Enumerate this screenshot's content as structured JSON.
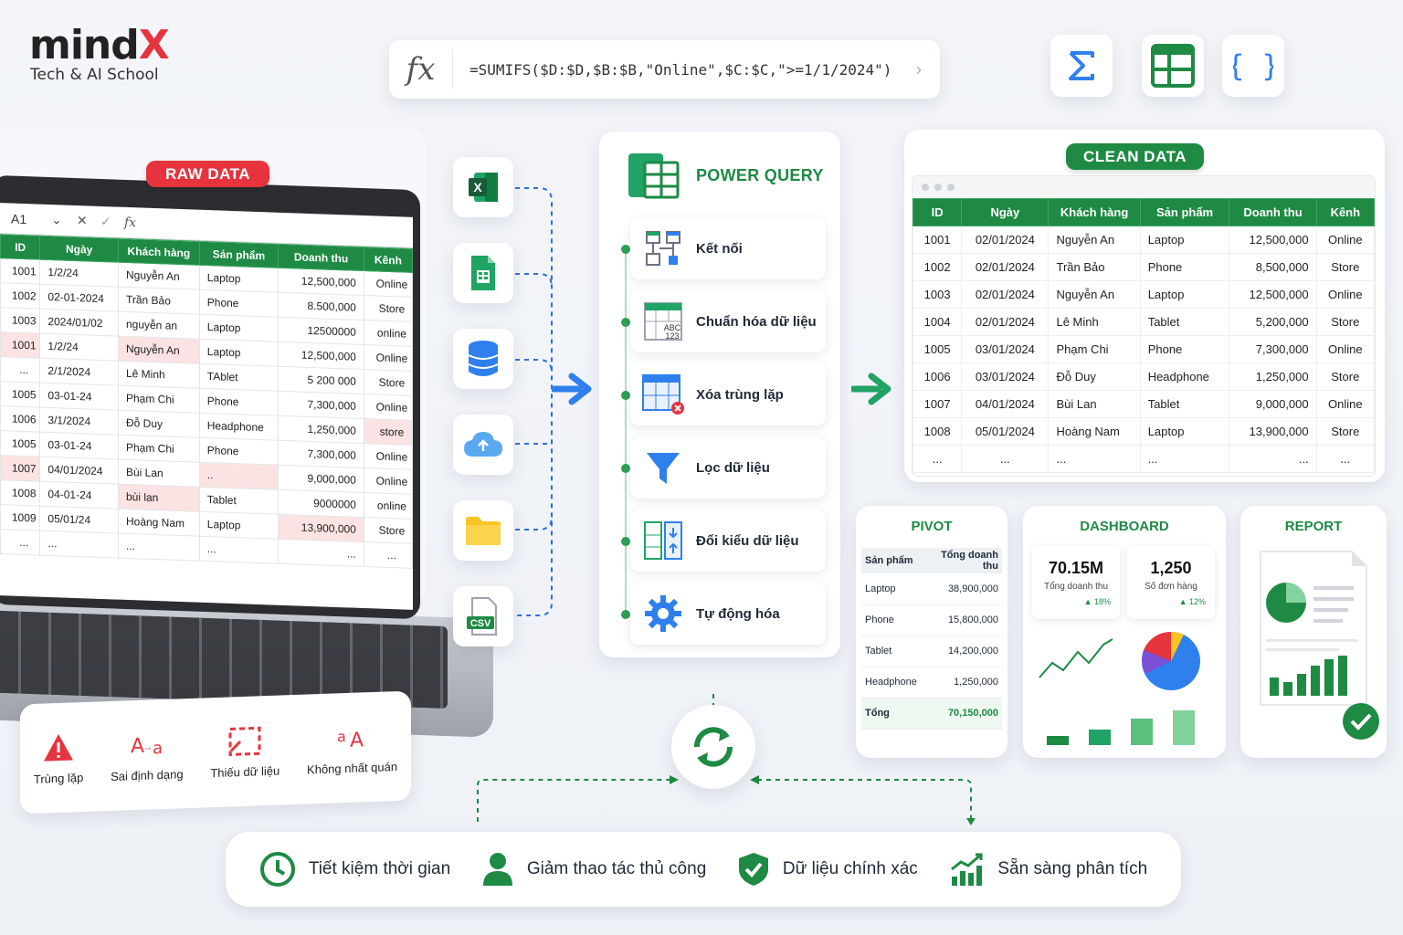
{
  "brand": {
    "logo_main": "mind",
    "logo_x": "X",
    "tagline": "Tech & AI School"
  },
  "formula_bar": {
    "fx": "fx",
    "formula": "=SUMIFS($D:$D,$B:$B,\"Online\",$C:$C,\">=1/1/2024\")"
  },
  "top_tools": [
    "sigma-icon",
    "table-icon",
    "braces-icon"
  ],
  "raw_data": {
    "label": "RAW DATA",
    "cell_ref": "A1",
    "fx": "fx",
    "columns": [
      "ID",
      "Ngày",
      "Khách hàng",
      "Sản phẩm",
      "Doanh thu",
      "Kênh"
    ],
    "rows": [
      [
        "1001",
        "1/2/24",
        "Nguyễn An",
        "Laptop",
        "12,500,000",
        "Online"
      ],
      [
        "1002",
        "02-01-2024",
        "Trần Bảo",
        "Phone",
        "8.500,000",
        "Store"
      ],
      [
        "1003",
        "2024/01/02",
        "nguyễn an",
        "Laptop",
        "12500000",
        "online"
      ],
      [
        "1001",
        "1/2/24",
        "Nguyễn An",
        "Laptop",
        "12,500,000",
        "Online"
      ],
      [
        "...",
        "2/1/2024",
        "Lê Minh",
        "TAblet",
        "5 200 000",
        "Store"
      ],
      [
        "1005",
        "03-01-24",
        "Phạm Chi",
        "Phone",
        "7,300,000",
        "Online"
      ],
      [
        "1006",
        "3/1/2024",
        "Đỗ Duy",
        "Headphone",
        "1,250,000",
        "store"
      ],
      [
        "1005",
        "03-01-24",
        "Phạm Chi",
        "Phone",
        "7,300,000",
        "Online"
      ],
      [
        "1007",
        "04/01/2024",
        "Bùi Lan",
        "..",
        "9,000,000",
        "Online"
      ],
      [
        "1008",
        "04-01-24",
        "bùi lan",
        "Tablet",
        "9000000",
        "online"
      ],
      [
        "1009",
        "05/01/24",
        "Hoàng Nam",
        "Laptop",
        "13,900,000",
        "Store"
      ],
      [
        "...",
        "...",
        "...",
        "...",
        "...",
        "..."
      ]
    ]
  },
  "issues": [
    {
      "icon": "warning-icon",
      "label": "Trùng lặp"
    },
    {
      "icon": "format-icon",
      "label": "Sai định dạng"
    },
    {
      "icon": "missing-data-icon",
      "label": "Thiếu dữ liệu"
    },
    {
      "icon": "case-icon",
      "label": "Không nhất quán"
    }
  ],
  "sources": [
    "excel-icon",
    "google-sheets-icon",
    "database-icon",
    "cloud-icon",
    "folder-icon",
    "csv-icon"
  ],
  "csv_label": "CSV",
  "power_query": {
    "title": "POWER QUERY",
    "steps": [
      {
        "icon": "connect-icon",
        "label": "Kết nối"
      },
      {
        "icon": "standardize-icon",
        "label": "Chuẩn hóa dữ liệu"
      },
      {
        "icon": "remove-duplicates-icon",
        "label": "Xóa trùng lặp"
      },
      {
        "icon": "filter-icon",
        "label": "Lọc dữ liệu"
      },
      {
        "icon": "change-type-icon",
        "label": "Đổi kiểu dữ liệu"
      },
      {
        "icon": "gear-icon",
        "label": "Tự động hóa"
      }
    ],
    "abc_label": "ABC",
    "num_label": "123"
  },
  "clean_data": {
    "label": "CLEAN DATA",
    "columns": [
      "ID",
      "Ngày",
      "Khách hàng",
      "Sản phẩm",
      "Doanh thu",
      "Kênh"
    ],
    "rows": [
      [
        "1001",
        "02/01/2024",
        "Nguyễn An",
        "Laptop",
        "12,500,000",
        "Online"
      ],
      [
        "1002",
        "02/01/2024",
        "Trần Bảo",
        "Phone",
        "8,500,000",
        "Store"
      ],
      [
        "1003",
        "02/01/2024",
        "Nguyễn An",
        "Laptop",
        "12,500,000",
        "Online"
      ],
      [
        "1004",
        "02/01/2024",
        "Lê Minh",
        "Tablet",
        "5,200,000",
        "Store"
      ],
      [
        "1005",
        "03/01/2024",
        "Phạm Chi",
        "Phone",
        "7,300,000",
        "Online"
      ],
      [
        "1006",
        "03/01/2024",
        "Đỗ Duy",
        "Headphone",
        "1,250,000",
        "Store"
      ],
      [
        "1007",
        "04/01/2024",
        "Bùi Lan",
        "Tablet",
        "9,000,000",
        "Online"
      ],
      [
        "1008",
        "05/01/2024",
        "Hoàng Nam",
        "Laptop",
        "13,900,000",
        "Store"
      ],
      [
        "...",
        "...",
        "...",
        "...",
        "...",
        "..."
      ]
    ]
  },
  "pivot": {
    "title": "PIVOT",
    "columns": [
      "Sản phẩm",
      "Tổng doanh thu"
    ],
    "rows": [
      [
        "Laptop",
        "38,900,000"
      ],
      [
        "Phone",
        "15,800,000"
      ],
      [
        "Tablet",
        "14,200,000"
      ],
      [
        "Headphone",
        "1,250,000"
      ]
    ],
    "total": [
      "Tổng",
      "70,150,000"
    ]
  },
  "dashboard": {
    "title": "DASHBOARD",
    "kpis": [
      {
        "value": "70.15M",
        "label": "Tổng doanh thu",
        "delta": "▲ 18%"
      },
      {
        "value": "1,250",
        "label": "Số đơn hàng",
        "delta": "▲ 12%"
      }
    ],
    "bar_levels": [
      0.25,
      0.45,
      0.75,
      1.0
    ],
    "colors": {
      "green": "#1e8a44",
      "blue": "#2f80ed",
      "red": "#e5343d",
      "yellow": "#f7c325",
      "purple": "#7b4fd6"
    }
  },
  "report": {
    "title": "REPORT",
    "bar_levels": [
      0.45,
      0.35,
      0.55,
      0.75,
      0.9,
      1.0
    ]
  },
  "benefits": [
    {
      "icon": "clock-icon",
      "label": "Tiết kiệm thời gian"
    },
    {
      "icon": "user-icon",
      "label": "Giảm thao tác thủ công"
    },
    {
      "icon": "shield-check-icon",
      "label": "Dữ liệu chính xác"
    },
    {
      "icon": "growth-chart-icon",
      "label": "Sẵn sàng phân tích"
    }
  ]
}
